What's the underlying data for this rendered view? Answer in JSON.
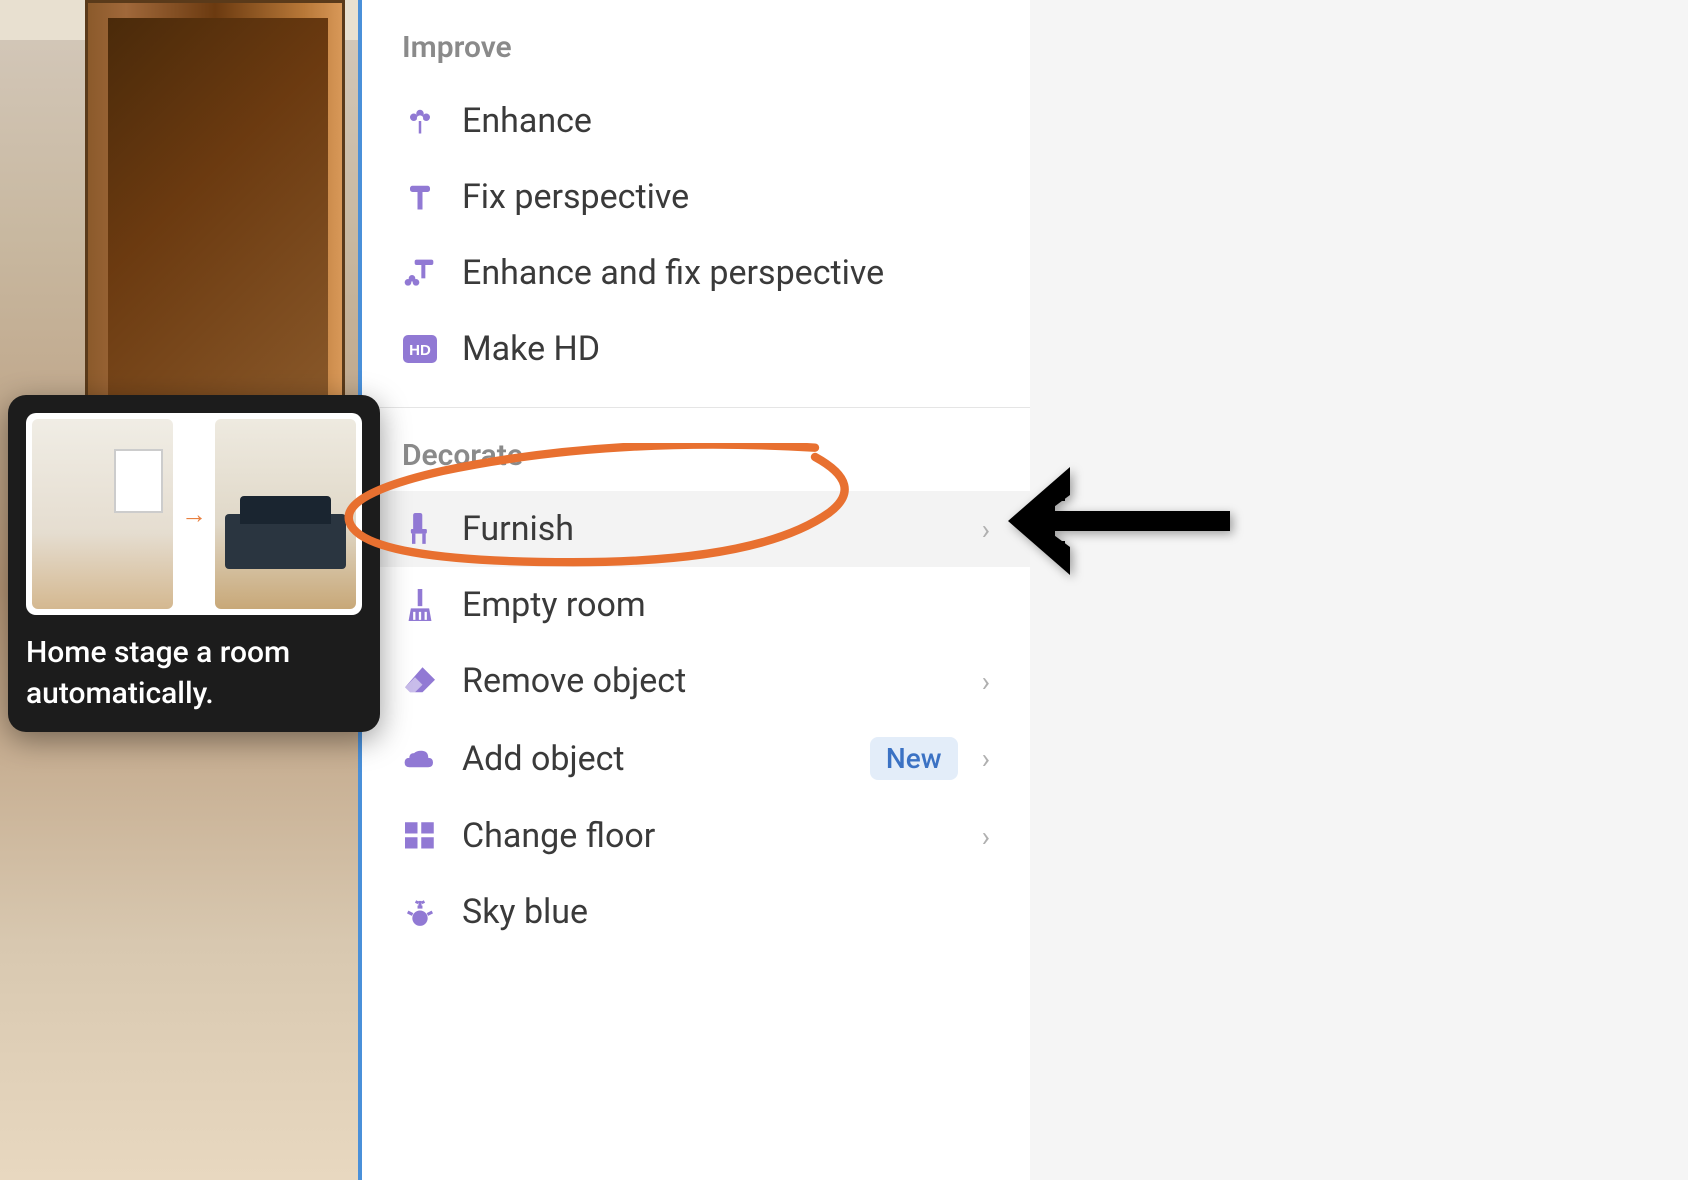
{
  "tooltip": {
    "text": "Home stage a room automatically."
  },
  "sections": {
    "improve": {
      "header": "Improve",
      "items": [
        {
          "label": "Enhance",
          "icon": "flower-icon"
        },
        {
          "label": "Fix perspective",
          "icon": "perspective-icon"
        },
        {
          "label": "Enhance and fix perspective",
          "icon": "enhance-perspective-icon"
        },
        {
          "label": "Make HD",
          "icon": "hd-icon"
        }
      ]
    },
    "decorate": {
      "header": "Decorate",
      "items": [
        {
          "label": "Furnish",
          "icon": "chair-icon",
          "chevron": true,
          "highlighted": true
        },
        {
          "label": "Empty room",
          "icon": "broom-icon"
        },
        {
          "label": "Remove object",
          "icon": "eraser-icon",
          "chevron": true
        },
        {
          "label": "Add object",
          "icon": "cloud-icon",
          "badge": "New",
          "chevron": true
        },
        {
          "label": "Change floor",
          "icon": "floor-icon",
          "chevron": true
        },
        {
          "label": "Sky blue",
          "icon": "sun-icon"
        }
      ]
    }
  },
  "colors": {
    "accent": "#9179d4",
    "annotation": "#e87030",
    "badge_bg": "#e3edf9",
    "badge_text": "#3b72c4"
  }
}
